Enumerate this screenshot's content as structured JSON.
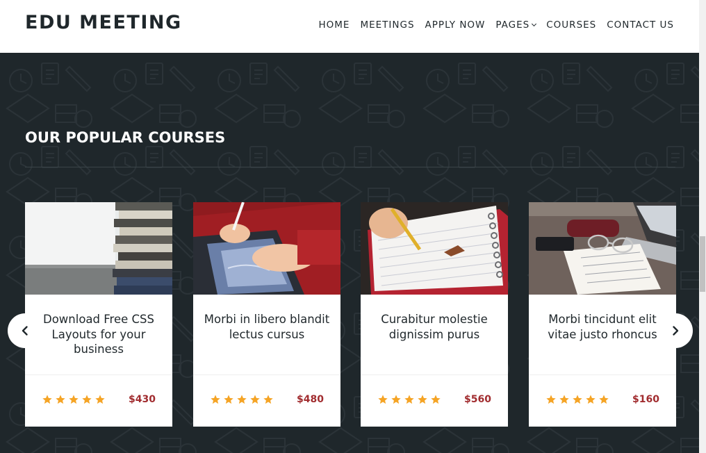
{
  "header": {
    "logo": "EDU MEETING",
    "nav": [
      {
        "label": "HOME"
      },
      {
        "label": "MEETINGS"
      },
      {
        "label": "APPLY NOW"
      },
      {
        "label": "PAGES",
        "has_dropdown": true
      },
      {
        "label": "COURSES"
      },
      {
        "label": "CONTACT US"
      }
    ]
  },
  "section": {
    "title": "OUR POPULAR COURSES"
  },
  "courses": [
    {
      "title": "Download Free CSS Layouts for your business",
      "price": "$430",
      "rating": 5,
      "image": "stack-of-books"
    },
    {
      "title": "Morbi in libero blandit lectus cursus",
      "price": "$480",
      "rating": 5,
      "image": "tablet-drawing"
    },
    {
      "title": "Curabitur molestie dignissim purus",
      "price": "$560",
      "rating": 5,
      "image": "notebook-pencil"
    },
    {
      "title": "Morbi tincidunt elit vitae justo rhoncus",
      "price": "$160",
      "rating": 5,
      "image": "desk-glasses-laptop"
    }
  ],
  "carousel": {
    "prev_icon": "chevron-left-icon",
    "next_icon": "chevron-right-icon"
  },
  "colors": {
    "header_bg": "#ffffff",
    "section_bg": "#1f272b",
    "star": "#f5a425",
    "price": "#a12c2f",
    "text_dark": "#1f272b"
  }
}
